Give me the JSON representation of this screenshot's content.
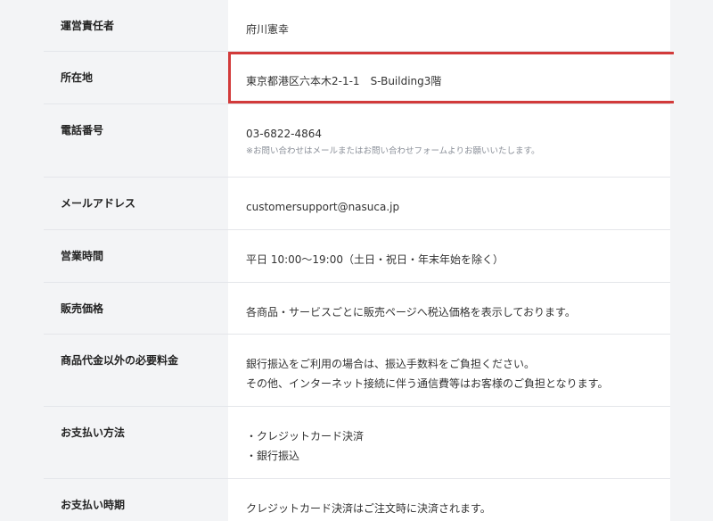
{
  "rows": [
    {
      "label": "運営責任者",
      "lines": [
        "府川憲幸"
      ]
    },
    {
      "label": "所在地",
      "lines": [
        "東京都港区六本木2-1-1　S-Building3階"
      ]
    },
    {
      "label": "電話番号",
      "lines": [
        "03-6822-4864"
      ],
      "note": "※お問い合わせはメールまたはお問い合わせフォームよりお願いいたします。"
    },
    {
      "label": "メールアドレス",
      "lines": [
        "customersupport@nasuca.jp"
      ]
    },
    {
      "label": "営業時間",
      "lines": [
        "平日 10:00〜19:00（土日・祝日・年末年始を除く）"
      ]
    },
    {
      "label": "販売価格",
      "lines": [
        "各商品・サービスごとに販売ページへ税込価格を表示しております。"
      ]
    },
    {
      "label": "商品代金以外の必要料金",
      "lines": [
        "銀行振込をご利用の場合は、振込手数料をご負担ください。",
        "その他、インターネット接続に伴う通信費等はお客様のご負担となります。"
      ]
    },
    {
      "label": "お支払い方法",
      "lines": [
        "・クレジットカード決済",
        "・銀行振込"
      ]
    },
    {
      "label": "お支払い時期",
      "lines": [
        "クレジットカード決済はご注文時に決済されます。"
      ]
    }
  ],
  "colors": {
    "highlight": "#d23a3a",
    "header_bg": "#f3f4f6",
    "cell_bg": "#ffffff"
  }
}
